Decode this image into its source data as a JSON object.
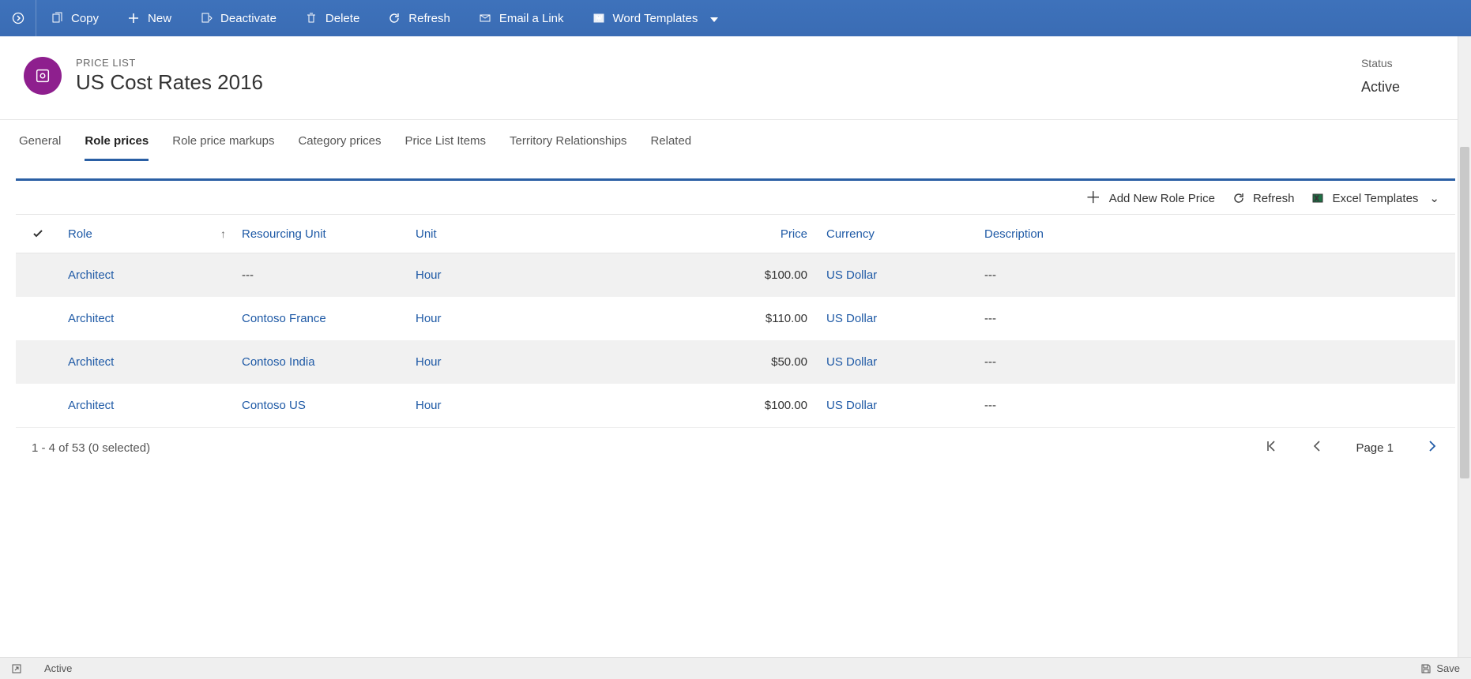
{
  "commandBar": {
    "copy": "Copy",
    "new": "New",
    "deactivate": "Deactivate",
    "delete": "Delete",
    "refresh": "Refresh",
    "emailLink": "Email a Link",
    "wordTemplates": "Word Templates"
  },
  "header": {
    "entityType": "PRICE LIST",
    "entityName": "US Cost Rates 2016",
    "statusLabel": "Status",
    "statusValue": "Active"
  },
  "tabs": [
    "General",
    "Role prices",
    "Role price markups",
    "Category prices",
    "Price List Items",
    "Territory Relationships",
    "Related"
  ],
  "activeTabIndex": 1,
  "subgridCommands": {
    "addNew": "Add New Role Price",
    "refresh": "Refresh",
    "excelTemplates": "Excel Templates"
  },
  "columns": {
    "role": "Role",
    "resourcingUnit": "Resourcing Unit",
    "unit": "Unit",
    "price": "Price",
    "currency": "Currency",
    "description": "Description"
  },
  "rows": [
    {
      "role": "Architect",
      "resourcingUnit": "---",
      "unit": "Hour",
      "price": "$100.00",
      "currency": "US Dollar",
      "description": "---"
    },
    {
      "role": "Architect",
      "resourcingUnit": "Contoso France",
      "unit": "Hour",
      "price": "$110.00",
      "currency": "US Dollar",
      "description": "---"
    },
    {
      "role": "Architect",
      "resourcingUnit": "Contoso India",
      "unit": "Hour",
      "price": "$50.00",
      "currency": "US Dollar",
      "description": "---"
    },
    {
      "role": "Architect",
      "resourcingUnit": "Contoso US",
      "unit": "Hour",
      "price": "$100.00",
      "currency": "US Dollar",
      "description": "---"
    }
  ],
  "footer": {
    "summary": "1 - 4 of 53 (0 selected)",
    "pageLabel": "Page 1"
  },
  "statusBar": {
    "state": "Active",
    "save": "Save"
  }
}
